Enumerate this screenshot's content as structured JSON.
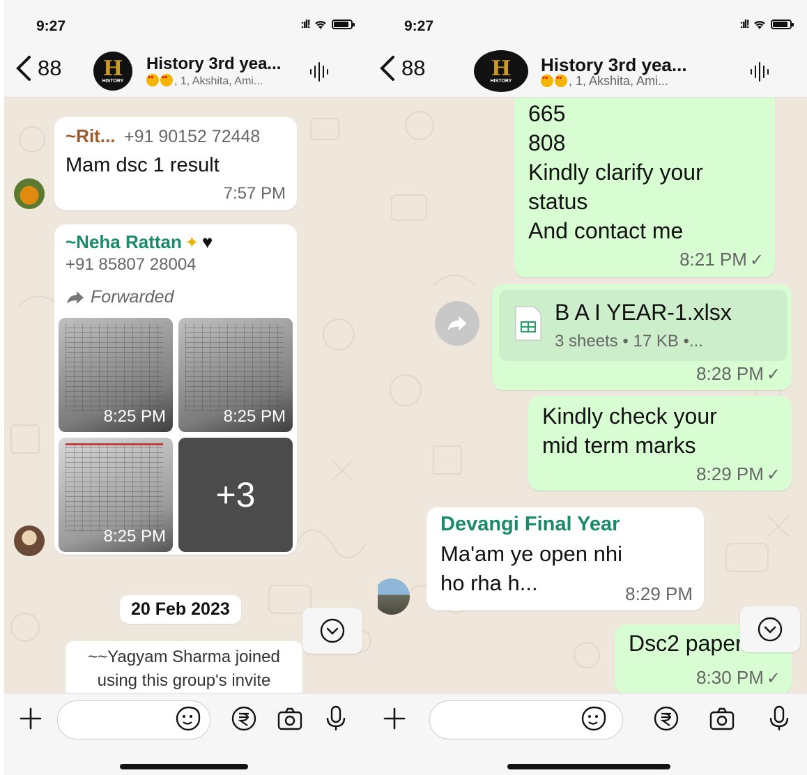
{
  "status": {
    "time": "9:27"
  },
  "header": {
    "back_count": "88",
    "title": "History 3rd yea...",
    "members": ", 1, Akshita, Ami...",
    "avatar_letter": "H",
    "avatar_sub": "HISTORY"
  },
  "left": {
    "msg1": {
      "sender": "~Rit...",
      "phone": "+91 90152 72448",
      "text": "Mam dsc 1 result",
      "time": "7:57 PM"
    },
    "msg2": {
      "sender": "~Neha Rattan",
      "phone": "+91 85807 28004",
      "forwarded": "Forwarded",
      "photo_times": [
        "8:25 PM",
        "8:25 PM",
        "8:25 PM"
      ],
      "more": "+3"
    },
    "date": "20 Feb 2023",
    "system": [
      "~~Yagyam Sharma joined",
      "using this group's invite"
    ]
  },
  "right": {
    "msg1": {
      "lines": [
        "665",
        "808",
        "Kindly clarify your",
        "status",
        "And contact me"
      ],
      "time": "8:21 PM"
    },
    "file": {
      "name": "B A I YEAR-1.xlsx",
      "info": "3 sheets • 17 KB •...",
      "time": "8:28 PM"
    },
    "msg3": {
      "lines": [
        "Kindly check your",
        "mid term marks"
      ],
      "time": "8:29 PM"
    },
    "msg4": {
      "sender": "Devangi Final Year",
      "lines": [
        "Ma'am ye open nhi",
        "ho rha h..."
      ],
      "time": "8:29 PM"
    },
    "msg5": {
      "text": "Dsc2 paper",
      "time": "8:30 PM"
    }
  },
  "colors": {
    "sender_rit": "#9b5a2b",
    "sender_green": "#1a8a6a",
    "sender_devangi": "#1a8a6a",
    "bubble_out": "#d9fdd3",
    "wallpaper": "#efe7dc"
  },
  "icons": [
    "back-chevron-icon",
    "waveform-icon",
    "plus-icon",
    "sticker-icon",
    "rupee-icon",
    "camera-icon",
    "mic-icon",
    "chevron-down-icon",
    "forward-icon",
    "spreadsheet-icon",
    "checkmark-icon"
  ]
}
